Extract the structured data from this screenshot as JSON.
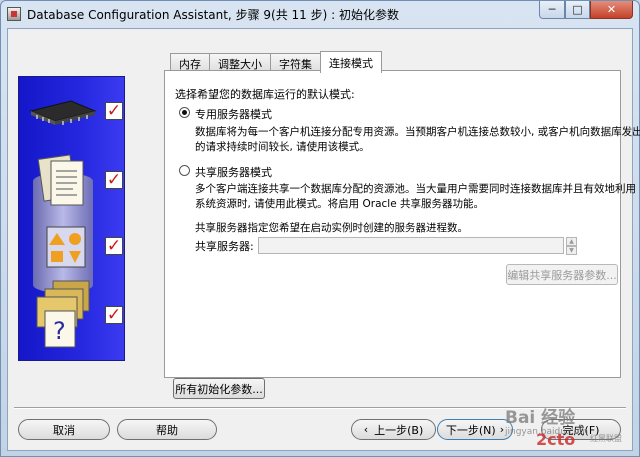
{
  "window": {
    "title": "Database Configuration Assistant, 步骤 9(共 11 步) : 初始化参数",
    "minimize_glyph": "─",
    "maximize_glyph": "□",
    "close_glyph": "✕"
  },
  "tabs": [
    {
      "label": "内存",
      "active": false
    },
    {
      "label": "调整大小",
      "active": false
    },
    {
      "label": "字符集",
      "active": false
    },
    {
      "label": "连接模式",
      "active": true
    }
  ],
  "panel": {
    "intro": "选择希望您的数据库运行的默认模式:",
    "dedicated": {
      "label": "专用服务器模式",
      "selected": true,
      "desc1": "数据库将为每一个客户机连接分配专用资源。当预期客户机连接总数较小, 或客户机向数据库发出",
      "desc2": "的请求持续时间较长, 请使用该模式。"
    },
    "shared": {
      "label": "共享服务器模式",
      "selected": false,
      "desc1": "多个客户端连接共享一个数据库分配的资源池。当大量用户需要同时连接数据库并且有效地利用",
      "desc2": "系统资源时, 请使用此模式。将启用 Oracle 共享服务器功能。"
    },
    "shared_note": "共享服务器指定您希望在启动实例时创建的服务器进程数。",
    "shared_servers_label": "共享服务器:",
    "shared_servers_value": "",
    "edit_shared_button": "编辑共享服务器参数..."
  },
  "all_params_button": "所有初始化参数...",
  "footer": {
    "cancel": "取消",
    "help": "帮助",
    "back": "上一步(B)",
    "next": "下一步(N)",
    "finish": "完成(F)"
  },
  "watermarks": {
    "baidu": "Bai  经验",
    "url": "jingyan.baidu.com",
    "logo": "2cto",
    "site": "红黑联盟"
  },
  "colors": {
    "panel_blue": "#2022d8",
    "check_red": "#d01616",
    "close_red": "#c4422a"
  }
}
